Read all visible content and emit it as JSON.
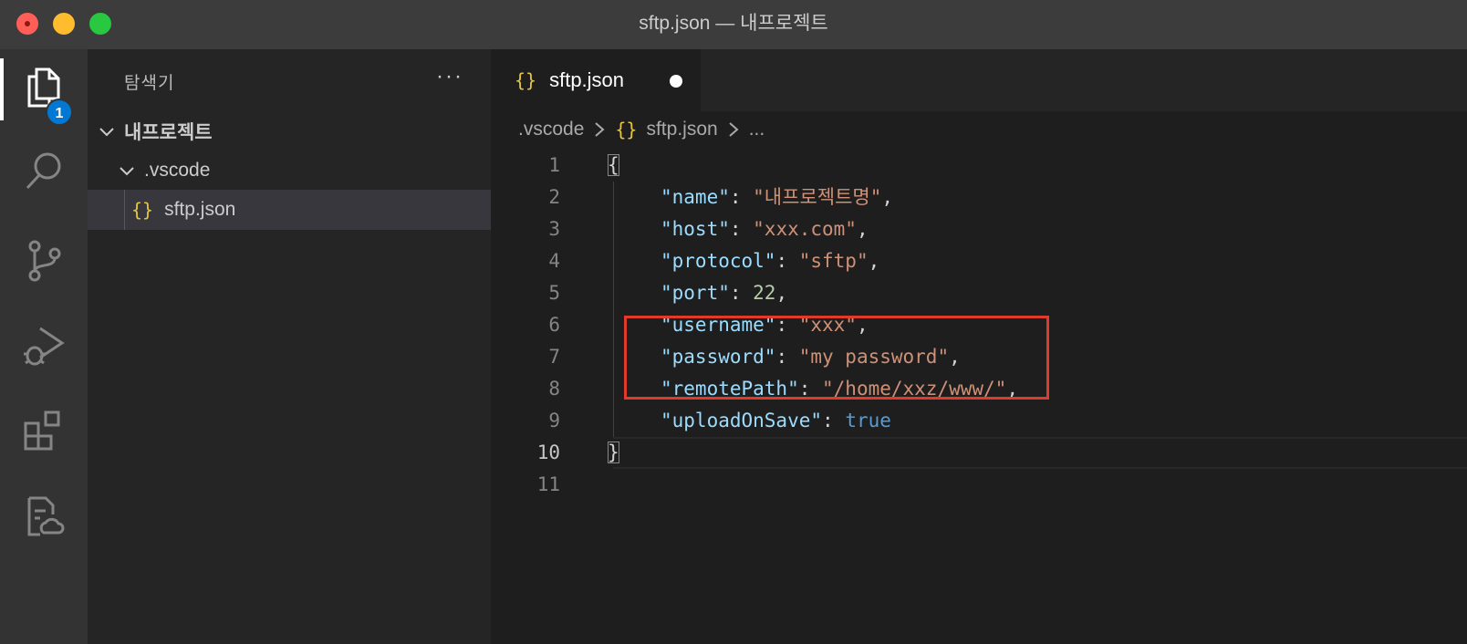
{
  "window": {
    "title": "sftp.json — 내프로젝트"
  },
  "activity_bar": {
    "items": [
      {
        "name": "explorer",
        "icon": "files-icon",
        "active": true,
        "badge": "1"
      },
      {
        "name": "search",
        "icon": "search-icon"
      },
      {
        "name": "source-control",
        "icon": "source-control-icon"
      },
      {
        "name": "run-debug",
        "icon": "run-debug-icon"
      },
      {
        "name": "extensions",
        "icon": "extensions-icon"
      },
      {
        "name": "remote-sftp",
        "icon": "file-cloud-icon"
      }
    ]
  },
  "sidebar": {
    "title": "탐색기",
    "more": "···",
    "tree": [
      {
        "label": "내프로젝트",
        "type": "folder",
        "expanded": true
      },
      {
        "label": ".vscode",
        "type": "folder",
        "expanded": true
      },
      {
        "label": "sftp.json",
        "type": "file",
        "glyph": "{}",
        "selected": true
      }
    ]
  },
  "editor": {
    "tab": {
      "glyph": "{}",
      "label": "sftp.json",
      "dirty": true
    },
    "breadcrumb": [
      ".vscode",
      "sftp.json",
      "..."
    ],
    "breadcrumb_glyph": "{}",
    "lines": [
      {
        "n": "1",
        "tokens": [
          {
            "t": "p",
            "v": "{"
          }
        ]
      },
      {
        "n": "2",
        "tokens": [
          {
            "t": "k",
            "v": "\"name\""
          },
          {
            "t": "p",
            "v": ": "
          },
          {
            "t": "s",
            "v": "\"내프로젝트명\""
          },
          {
            "t": "p",
            "v": ","
          }
        ]
      },
      {
        "n": "3",
        "tokens": [
          {
            "t": "k",
            "v": "\"host\""
          },
          {
            "t": "p",
            "v": ": "
          },
          {
            "t": "s",
            "v": "\"xxx.com\""
          },
          {
            "t": "p",
            "v": ","
          }
        ]
      },
      {
        "n": "4",
        "tokens": [
          {
            "t": "k",
            "v": "\"protocol\""
          },
          {
            "t": "p",
            "v": ": "
          },
          {
            "t": "s",
            "v": "\"sftp\""
          },
          {
            "t": "p",
            "v": ","
          }
        ]
      },
      {
        "n": "5",
        "tokens": [
          {
            "t": "k",
            "v": "\"port\""
          },
          {
            "t": "p",
            "v": ": "
          },
          {
            "t": "n",
            "v": "22"
          },
          {
            "t": "p",
            "v": ","
          }
        ]
      },
      {
        "n": "6",
        "tokens": [
          {
            "t": "k",
            "v": "\"username\""
          },
          {
            "t": "p",
            "v": ": "
          },
          {
            "t": "s",
            "v": "\"xxx\""
          },
          {
            "t": "p",
            "v": ","
          }
        ]
      },
      {
        "n": "7",
        "tokens": [
          {
            "t": "k",
            "v": "\"password\""
          },
          {
            "t": "p",
            "v": ": "
          },
          {
            "t": "s",
            "v": "\"my password\""
          },
          {
            "t": "p",
            "v": ","
          }
        ]
      },
      {
        "n": "8",
        "tokens": [
          {
            "t": "k",
            "v": "\"remotePath\""
          },
          {
            "t": "p",
            "v": ": "
          },
          {
            "t": "s",
            "v": "\"/home/xxz/www/\""
          },
          {
            "t": "p",
            "v": ","
          }
        ]
      },
      {
        "n": "9",
        "tokens": [
          {
            "t": "k",
            "v": "\"uploadOnSave\""
          },
          {
            "t": "p",
            "v": ": "
          },
          {
            "t": "b",
            "v": "true"
          }
        ]
      },
      {
        "n": "10",
        "tokens": [
          {
            "t": "p",
            "v": "}"
          }
        ]
      },
      {
        "n": "11",
        "tokens": []
      }
    ],
    "current_line": "10"
  },
  "colors": {
    "accent": "#0078d4",
    "highlight_box": "#e03a2b",
    "json_glyph": "#e2c541"
  }
}
